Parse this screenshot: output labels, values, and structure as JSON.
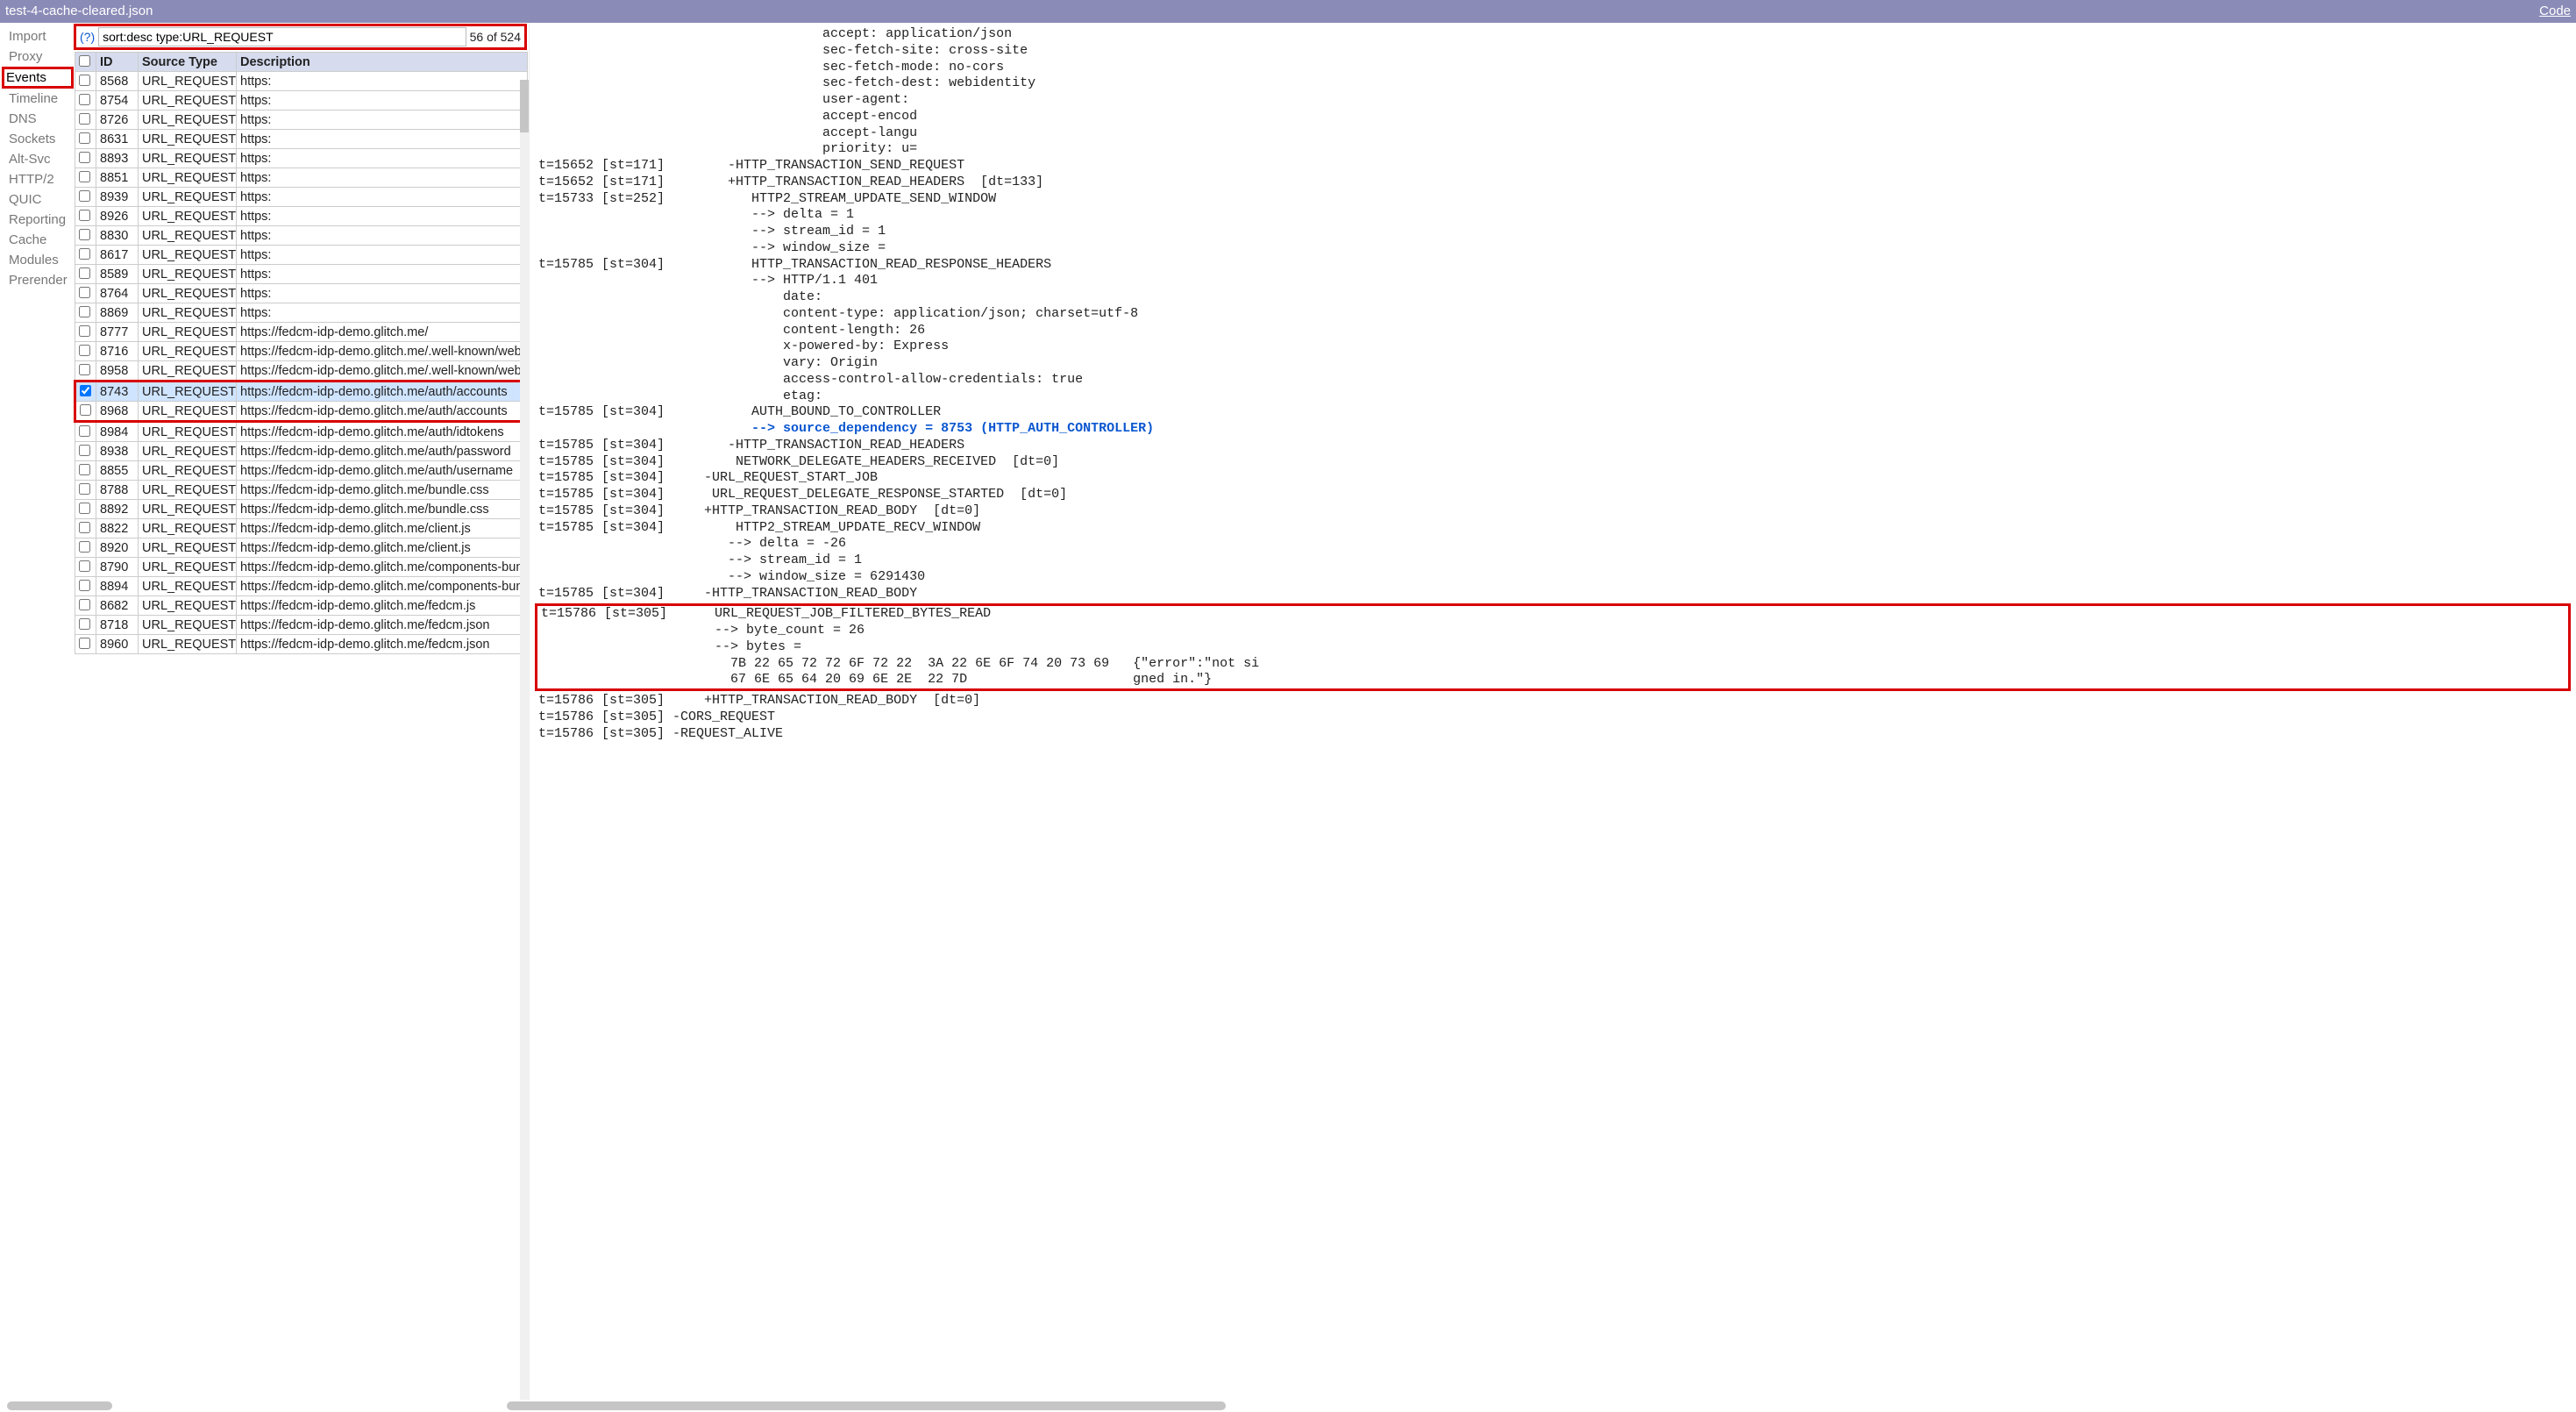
{
  "title": "test-4-cache-cleared.json",
  "code_label": "Code",
  "sidebar": {
    "items": [
      {
        "label": "Import"
      },
      {
        "label": "Proxy"
      },
      {
        "label": "Events",
        "active": true,
        "highlight": true
      },
      {
        "label": "Timeline"
      },
      {
        "label": "DNS"
      },
      {
        "label": "Sockets"
      },
      {
        "label": "Alt-Svc"
      },
      {
        "label": "HTTP/2"
      },
      {
        "label": "QUIC"
      },
      {
        "label": "Reporting"
      },
      {
        "label": "Cache"
      },
      {
        "label": "Modules"
      },
      {
        "label": "Prerender"
      }
    ]
  },
  "search": {
    "help": "(?)",
    "value": "sort:desc type:URL_REQUEST",
    "count": "56 of 524"
  },
  "table": {
    "headers": {
      "cb": "",
      "id": "ID",
      "type": "Source Type",
      "desc": "Description"
    }
  },
  "rows": [
    {
      "id": "8568",
      "type": "URL_REQUEST",
      "desc": "https:"
    },
    {
      "id": "8754",
      "type": "URL_REQUEST",
      "desc": "https:"
    },
    {
      "id": "8726",
      "type": "URL_REQUEST",
      "desc": "https:"
    },
    {
      "id": "8631",
      "type": "URL_REQUEST",
      "desc": "https:"
    },
    {
      "id": "8893",
      "type": "URL_REQUEST",
      "desc": "https:"
    },
    {
      "id": "8851",
      "type": "URL_REQUEST",
      "desc": "https:"
    },
    {
      "id": "8939",
      "type": "URL_REQUEST",
      "desc": "https:"
    },
    {
      "id": "8926",
      "type": "URL_REQUEST",
      "desc": "https:"
    },
    {
      "id": "8830",
      "type": "URL_REQUEST",
      "desc": "https:"
    },
    {
      "id": "8617",
      "type": "URL_REQUEST",
      "desc": "https:"
    },
    {
      "id": "8589",
      "type": "URL_REQUEST",
      "desc": "https:"
    },
    {
      "id": "8764",
      "type": "URL_REQUEST",
      "desc": "https:"
    },
    {
      "id": "8869",
      "type": "URL_REQUEST",
      "desc": "https:"
    },
    {
      "id": "8777",
      "type": "URL_REQUEST",
      "desc": "https://fedcm-idp-demo.glitch.me/"
    },
    {
      "id": "8716",
      "type": "URL_REQUEST",
      "desc": "https://fedcm-idp-demo.glitch.me/.well-known/web-iden"
    },
    {
      "id": "8958",
      "type": "URL_REQUEST",
      "desc": "https://fedcm-idp-demo.glitch.me/.well-known/web-iden"
    },
    {
      "id": "8743",
      "type": "URL_REQUEST",
      "desc": "https://fedcm-idp-demo.glitch.me/auth/accounts",
      "selected": true,
      "checked": true,
      "hlg": "top"
    },
    {
      "id": "8968",
      "type": "URL_REQUEST",
      "desc": "https://fedcm-idp-demo.glitch.me/auth/accounts",
      "hlg": "bottom"
    },
    {
      "id": "8984",
      "type": "URL_REQUEST",
      "desc": "https://fedcm-idp-demo.glitch.me/auth/idtokens"
    },
    {
      "id": "8938",
      "type": "URL_REQUEST",
      "desc": "https://fedcm-idp-demo.glitch.me/auth/password"
    },
    {
      "id": "8855",
      "type": "URL_REQUEST",
      "desc": "https://fedcm-idp-demo.glitch.me/auth/username"
    },
    {
      "id": "8788",
      "type": "URL_REQUEST",
      "desc": "https://fedcm-idp-demo.glitch.me/bundle.css"
    },
    {
      "id": "8892",
      "type": "URL_REQUEST",
      "desc": "https://fedcm-idp-demo.glitch.me/bundle.css"
    },
    {
      "id": "8822",
      "type": "URL_REQUEST",
      "desc": "https://fedcm-idp-demo.glitch.me/client.js"
    },
    {
      "id": "8920",
      "type": "URL_REQUEST",
      "desc": "https://fedcm-idp-demo.glitch.me/client.js"
    },
    {
      "id": "8790",
      "type": "URL_REQUEST",
      "desc": "https://fedcm-idp-demo.glitch.me/components-bundle.j"
    },
    {
      "id": "8894",
      "type": "URL_REQUEST",
      "desc": "https://fedcm-idp-demo.glitch.me/components-bundle.j"
    },
    {
      "id": "8682",
      "type": "URL_REQUEST",
      "desc": "https://fedcm-idp-demo.glitch.me/fedcm.js"
    },
    {
      "id": "8718",
      "type": "URL_REQUEST",
      "desc": "https://fedcm-idp-demo.glitch.me/fedcm.json"
    },
    {
      "id": "8960",
      "type": "URL_REQUEST",
      "desc": "https://fedcm-idp-demo.glitch.me/fedcm.json"
    }
  ],
  "log": {
    "pre1": "                                    accept: application/json\n                                    sec-fetch-site: cross-site\n                                    sec-fetch-mode: no-cors\n                                    sec-fetch-dest: webidentity\n                                    user-agent:\n                                    accept-encod\n                                    accept-langu\n                                    priority: u=\nt=15652 [st=171]        -HTTP_TRANSACTION_SEND_REQUEST\nt=15652 [st=171]        +HTTP_TRANSACTION_READ_HEADERS  [dt=133]\nt=15733 [st=252]           HTTP2_STREAM_UPDATE_SEND_WINDOW\n                           --> delta = 1\n                           --> stream_id = 1\n                           --> window_size =\nt=15785 [st=304]           HTTP_TRANSACTION_READ_RESPONSE_HEADERS\n                           --> HTTP/1.1 401\n                               date:\n                               content-type: application/json; charset=utf-8\n                               content-length: 26\n                               x-powered-by: Express\n                               vary: Origin\n                               access-control-allow-credentials: true\n                               etag:\nt=15785 [st=304]           AUTH_BOUND_TO_CONTROLLER",
    "blue": "                           --> source_dependency = 8753 (HTTP_AUTH_CONTROLLER)",
    "pre2": "t=15785 [st=304]        -HTTP_TRANSACTION_READ_HEADERS\nt=15785 [st=304]         NETWORK_DELEGATE_HEADERS_RECEIVED  [dt=0]\nt=15785 [st=304]     -URL_REQUEST_START_JOB\nt=15785 [st=304]      URL_REQUEST_DELEGATE_RESPONSE_STARTED  [dt=0]\nt=15785 [st=304]     +HTTP_TRANSACTION_READ_BODY  [dt=0]\nt=15785 [st=304]         HTTP2_STREAM_UPDATE_RECV_WINDOW\n                        --> delta = -26\n                        --> stream_id = 1\n                        --> window_size = 6291430\nt=15785 [st=304]     -HTTP_TRANSACTION_READ_BODY",
    "hl": "t=15786 [st=305]      URL_REQUEST_JOB_FILTERED_BYTES_READ\n                      --> byte_count = 26\n                      --> bytes =\n                        7B 22 65 72 72 6F 72 22  3A 22 6E 6F 74 20 73 69   {\"error\":\"not si\n                        67 6E 65 64 20 69 6E 2E  22 7D                     gned in.\"}",
    "post": "t=15786 [st=305]     +HTTP_TRANSACTION_READ_BODY  [dt=0]\nt=15786 [st=305] -CORS_REQUEST\nt=15786 [st=305] -REQUEST_ALIVE"
  }
}
